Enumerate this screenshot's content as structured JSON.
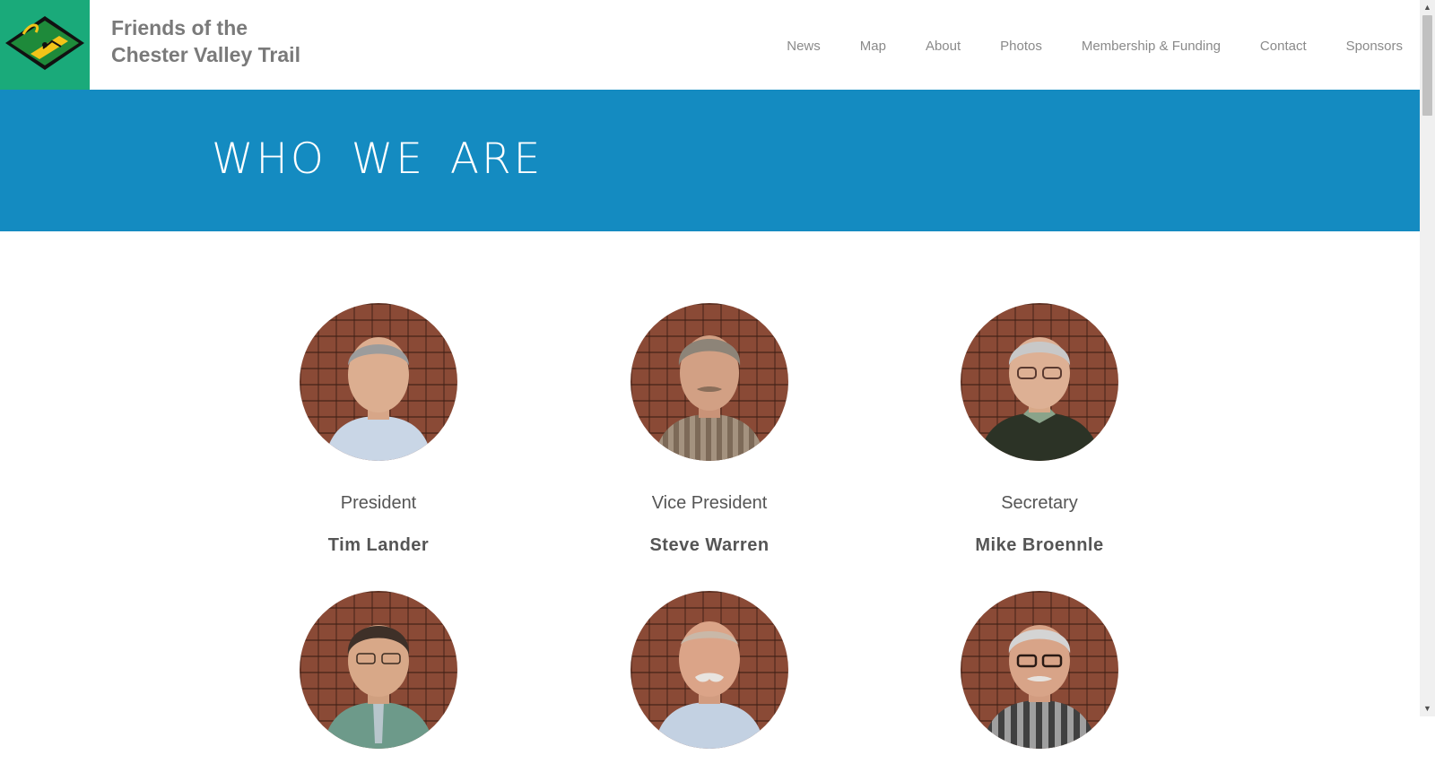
{
  "site": {
    "title_line1": "Friends of the",
    "title_line2": "Chester Valley Trail",
    "logo_icon": "trail-logo-icon"
  },
  "nav": {
    "items": [
      {
        "label": "News"
      },
      {
        "label": "Map"
      },
      {
        "label": "About"
      },
      {
        "label": "Photos"
      },
      {
        "label": "Membership & Funding"
      },
      {
        "label": "Contact"
      },
      {
        "label": "Sponsors"
      }
    ]
  },
  "hero": {
    "title": "WHO WE ARE"
  },
  "people": [
    {
      "role": "President",
      "name": "Tim Lander"
    },
    {
      "role": "Vice President",
      "name": "Steve Warren"
    },
    {
      "role": "Secretary",
      "name": "Mike Broennle"
    },
    {
      "role": "",
      "name": ""
    },
    {
      "role": "",
      "name": ""
    },
    {
      "role": "",
      "name": ""
    }
  ],
  "colors": {
    "header_bg": "#ffffff",
    "logo_bg": "#1aaa7a",
    "hero_bg": "#148bc1",
    "text": "#555555",
    "nav_text": "#8a8a8a"
  }
}
